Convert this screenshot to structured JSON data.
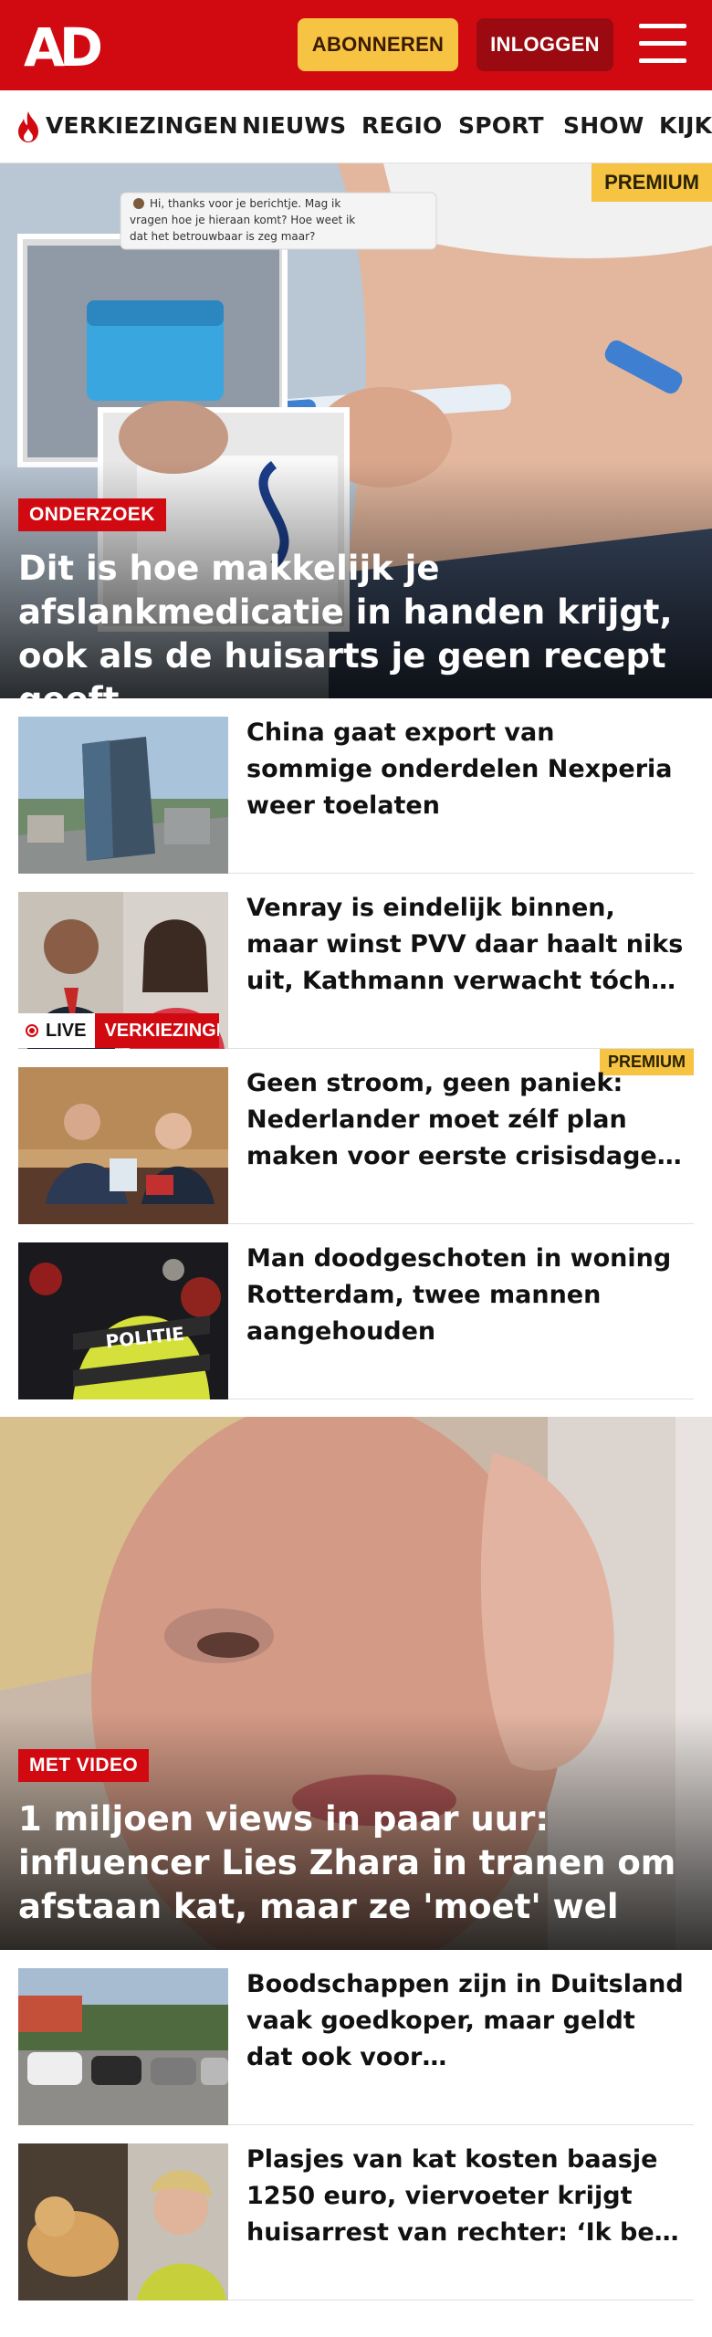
{
  "header": {
    "logo_text": "AD",
    "subscribe_label": "ABONNEREN",
    "login_label": "INLOGGEN",
    "brand_color": "#d10a11",
    "subscribe_color": "#f6c342"
  },
  "nav": {
    "items": [
      {
        "label": "VERKIEZINGEN",
        "icon": "flame-icon"
      },
      {
        "label": "NIEUWS"
      },
      {
        "label": "REGIO"
      },
      {
        "label": "SPORT"
      },
      {
        "label": "SHOW"
      },
      {
        "label": "KIJK"
      }
    ]
  },
  "hero": {
    "premium_label": "PREMIUM",
    "section_label": "ONDERZOEK",
    "title": "Dit is hoe makkelijk je afslankmedicatie in handen krijgt, ook als de huisarts je geen recept geeft",
    "chat_bubble": "Hi, thanks voor je berichtje. Mag ik vragen hoe je hieraan komt? Hoe weet ik dat het betrouwbaar is zeg maar?"
  },
  "articles_top": [
    {
      "title": "China gaat export van sommige onderdelen Nexperia weer toelaten"
    },
    {
      "title": "Venray is eindelijk binnen, maar winst PVV daar haalt niks uit, Kathmann verwacht tóch Kamerzetels",
      "live_label": "LIVE",
      "live_category": "VERKIEZINGEN"
    },
    {
      "title": "Geen stroom, geen paniek: Nederlander moet zélf plan maken voor eerste crisisdagen, zegt kabinet",
      "premium_label": "PREMIUM"
    },
    {
      "title": "Man doodgeschoten in woning Rotterdam, twee mannen aangehouden",
      "thumb_text": "POLITIE"
    }
  ],
  "feature": {
    "badge_label": "MET VIDEO",
    "title": "1 miljoen views in paar uur: influencer Lies Zhara in tranen om afstaan kat, maar ze 'moet' wel"
  },
  "articles_bottom": [
    {
      "title": "Boodschappen zijn in Duitsland vaak goedkoper, maar geldt dat ook voor tweedehandsauto’s?"
    },
    {
      "title": "Plasjes van kat kosten baasje 1250 euro, viervoeter krijgt huisarrest van rechter: ‘Ik ben niet blij’"
    }
  ]
}
